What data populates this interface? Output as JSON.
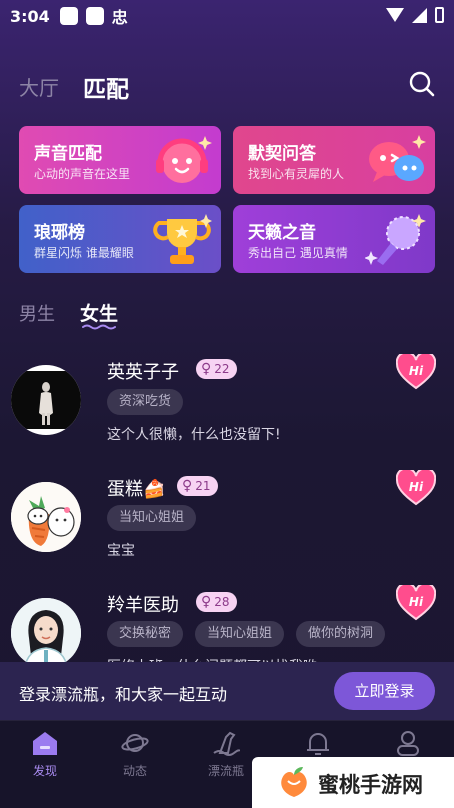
{
  "status_bar": {
    "time": "3:04",
    "glyph": "忠"
  },
  "header": {
    "tab_hall": "大厅",
    "tab_match": "匹配"
  },
  "feature_cards": {
    "voice": {
      "title": "声音匹配",
      "subtitle": "心动的声音在这里"
    },
    "quiz": {
      "title": "默契问答",
      "subtitle": "找到心有灵犀的人"
    },
    "rank": {
      "title": "琅琊榜",
      "subtitle": "群星闪烁 谁最耀眼"
    },
    "sound": {
      "title": "天籁之音",
      "subtitle": "秀出自己 遇见真情"
    }
  },
  "gender_tabs": {
    "male": "男生",
    "female": "女生"
  },
  "users": [
    {
      "name": "英英子子",
      "age_symbol": "♀",
      "age": "22",
      "tags": [
        "资深吃货"
      ],
      "bio": "这个人很懒，什么也没留下!",
      "hi": "Hi"
    },
    {
      "name": "蛋糕🍰",
      "age_symbol": "♀",
      "age": "21",
      "tags": [
        "当知心姐姐"
      ],
      "bio": "宝宝",
      "hi": "Hi"
    },
    {
      "name": "羚羊医助",
      "age_symbol": "♀",
      "age": "28",
      "tags": [
        "交换秘密",
        "当知心姐姐",
        "做你的树洞"
      ],
      "bio": "医修上班，什么问题都可以找我哟",
      "hi": "Hi"
    }
  ],
  "login_banner": {
    "text": "登录漂流瓶，和大家一起互动",
    "button": "立即登录"
  },
  "bottom_nav": [
    {
      "label": "发现",
      "active": true
    },
    {
      "label": "动态",
      "active": false
    },
    {
      "label": "漂流瓶",
      "active": false
    },
    {
      "label": "",
      "active": false
    },
    {
      "label": "",
      "active": false
    }
  ],
  "watermark": {
    "text": "蜜桃手游网"
  },
  "colors": {
    "accent": "#7d57d8",
    "active_nav": "#a98bf0",
    "hi_pink": "#ff4d8d"
  }
}
